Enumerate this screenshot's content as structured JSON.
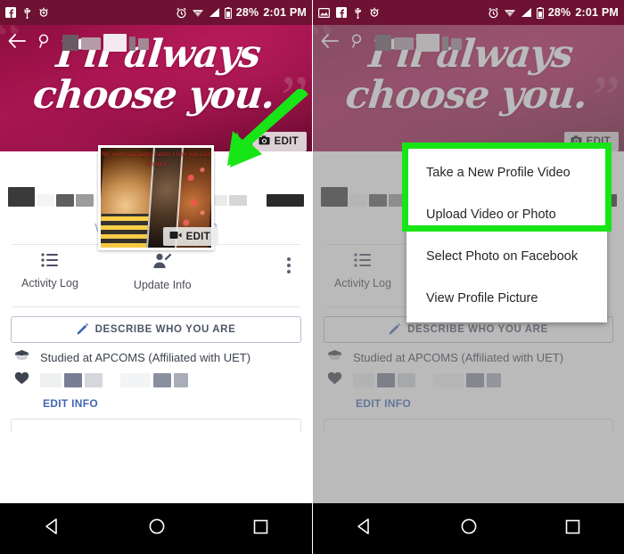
{
  "status_bar": {
    "icons_left_panel": [
      "facebook-icon",
      "usb-icon",
      "android-debug-icon"
    ],
    "icons_left_panel_right": [
      "photo-icon",
      "facebook-icon",
      "usb-icon",
      "android-debug-icon"
    ],
    "icons_right": [
      "alarm-icon",
      "wifi-icon",
      "signal-icon",
      "battery-icon"
    ],
    "battery": "28%",
    "time": "2:01 PM"
  },
  "cover": {
    "script_text": "I'll always\nchoose you.",
    "quote_open": "“",
    "quote_close": "”",
    "edit_cover_label": "EDIT",
    "edit_cover_icon": "camera-icon"
  },
  "profile": {
    "photo_caption": "My sweet and happy family\nI love you a lot so much",
    "edit_video_label": "EDIT",
    "edit_video_icon": "video-camera-icon"
  },
  "identity": {
    "name_redacted": true,
    "city_prompt": "What city are you from?"
  },
  "actions": {
    "activity_log": {
      "label": "Activity Log",
      "icon": "list-icon"
    },
    "update_info": {
      "label": "Update Info",
      "icon": "person-edit-icon"
    },
    "overflow": {
      "icon": "more-vertical-icon"
    }
  },
  "describe": {
    "label": "DESCRIBE WHO YOU ARE",
    "icon": "pencil-icon"
  },
  "info": {
    "education": {
      "icon": "graduation-cap-icon",
      "text": "Studied at APCOMS (Affiliated with UET)"
    },
    "relationship": {
      "icon": "heart-icon",
      "text_redacted": true
    },
    "edit_info_link": "EDIT INFO"
  },
  "menu": {
    "items": [
      "Take a New Profile Video",
      "Upload Video or Photo",
      "Select Photo on Facebook",
      "View Profile Picture"
    ],
    "highlight_color": "#18e516",
    "highlighted_indices": [
      0,
      1
    ]
  },
  "annotation": {
    "arrow_color": "#18e516",
    "arrow_direction": "down-left",
    "arrow_target": "profile-photo"
  },
  "navbar": {
    "back": "back-triangle-icon",
    "home": "home-circle-icon",
    "recents": "recents-square-icon"
  },
  "colors": {
    "cover_magenta": "#8e0f3f",
    "status_bar": "#6d1233",
    "link_blue": "#4267b2",
    "city_link_blue": "#93a7d4",
    "green": "#18e516"
  }
}
